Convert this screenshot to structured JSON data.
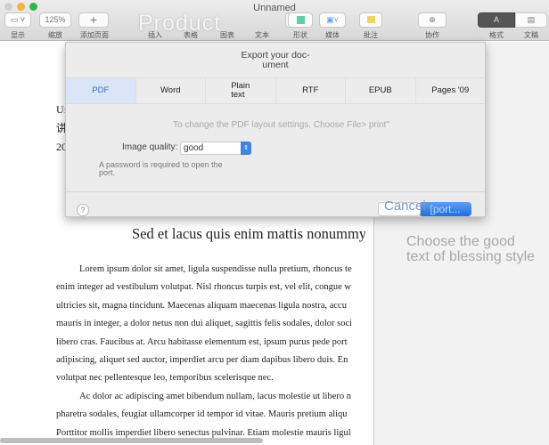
{
  "window": {
    "title": "Unnamed",
    "overlay_text": "Product"
  },
  "toolbar": {
    "items": [
      {
        "label": "显示",
        "icon": "view-icon"
      },
      {
        "label": "缩放",
        "value": "125%"
      },
      {
        "label": "添加页面",
        "icon": "plus-icon"
      },
      {
        "label": "插入",
        "icon": "insert-icon"
      },
      {
        "label": "表格",
        "icon": "table-icon"
      },
      {
        "label": "图表",
        "icon": "chart-icon"
      },
      {
        "label": "文本",
        "icon": "text-icon"
      },
      {
        "label": "形状",
        "icon": "shape-icon"
      },
      {
        "label": "媒体",
        "icon": "media-icon"
      },
      {
        "label": "批注",
        "icon": "comment-icon"
      },
      {
        "label": "协作",
        "icon": "collaborate-icon"
      },
      {
        "label": "格式",
        "icon": "format-icon"
      },
      {
        "label": "文稿",
        "icon": "document-icon"
      }
    ]
  },
  "dialog": {
    "title": "Export your doc-\nument",
    "tabs": [
      "PDF",
      "Word",
      "Plain\ntext",
      "RTF",
      "EPUB",
      "Pages '09"
    ],
    "selected_tab": "PDF",
    "info": "To change the PDF layout settings, Choose File> print\"",
    "image_quality_label": "Image quality:",
    "image_quality_value": "good",
    "password_text": "A password is required to open the\nport.",
    "help": "?",
    "cancel": "Cancel",
    "export": "[port..."
  },
  "document": {
    "side_fragments": [
      "U:",
      "讲",
      "20"
    ],
    "heading": "Sed et lacus quis enim mattis nonummy",
    "lines": [
      "Lorem ipsum dolor sit amet, ligula suspendisse nulla pretium, rhoncus te",
      "enim integer ad vestibulum volutpat. Nisl rhoncus turpis est, vel elit, congue w",
      "ultricies sit, magna tincidunt. Maecenas aliquam maecenas ligula nostra, accu",
      "mauris in integer, a dolor netus non dui aliquet, sagittis felis sodales, dolor soci",
      "libero cras. Faucibus at. Arcu habitasse elementum est, ipsum purus pede port",
      "adipiscing, aliquet sed auctor, imperdiet arcu per diam dapibus libero duis. En",
      "volutpat nec pellentesque leo, temporibus scelerisque nec.",
      "Ac dolor ac adipiscing amet bibendum nullam, lacus molestie ut libero n",
      "pharetra sodales, feugiat ullamcorper id tempor id vitae. Mauris pretium aliqu",
      "Porttitor mollis imperdiet libero senectus pulvinar. Etiam molestie mauris ligul"
    ]
  },
  "sidebar": {
    "hint": "Choose the good\ntext of blessing style"
  }
}
